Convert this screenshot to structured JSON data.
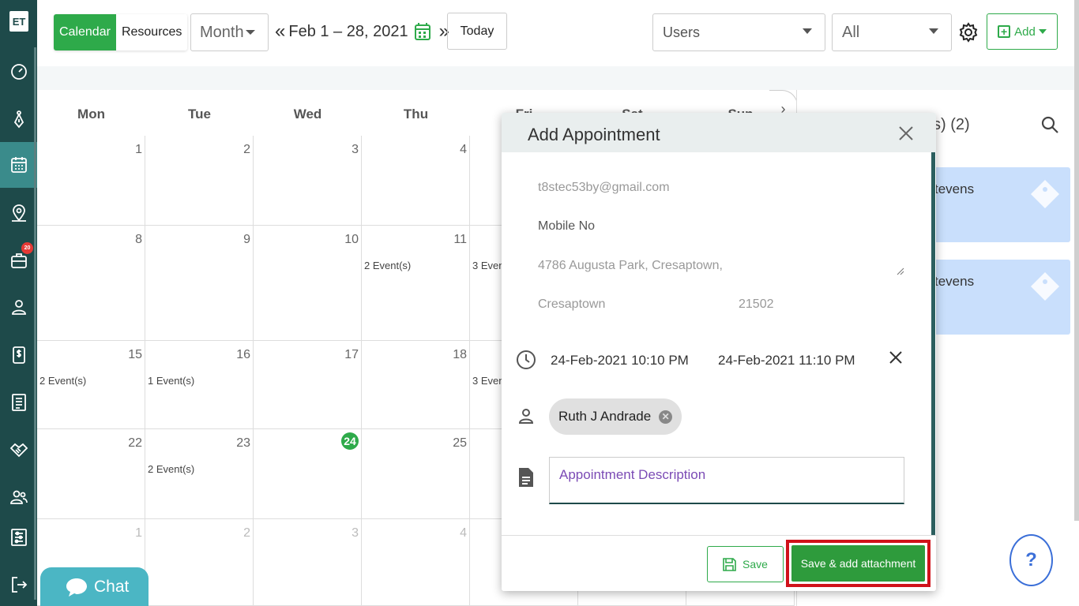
{
  "app": {
    "logo_text": "ET",
    "badge_count": "20"
  },
  "sidebar": {
    "items": [
      {
        "name": "dashboard-icon"
      },
      {
        "name": "pen-tool-icon"
      },
      {
        "name": "calendar-icon"
      },
      {
        "name": "map-pin-icon"
      },
      {
        "name": "briefcase-icon"
      },
      {
        "name": "user-icon"
      },
      {
        "name": "dollar-icon"
      },
      {
        "name": "list-icon"
      },
      {
        "name": "handshake-icon"
      },
      {
        "name": "users-icon"
      },
      {
        "name": "sliders-icon"
      },
      {
        "name": "logout-icon"
      }
    ]
  },
  "toolbar": {
    "calendar_tab": "Calendar",
    "resources_tab": "Resources",
    "view_select": "Month",
    "prev_arrow": "«",
    "date_range": "Feb 1 – 28, 2021",
    "next_arrow": "»",
    "today": "Today",
    "users_select": "Users",
    "all_select": "All",
    "add": "Add"
  },
  "calendar": {
    "weekdays": [
      "Mon",
      "Tue",
      "Wed",
      "Thu",
      "Fri",
      "Sat",
      "Sun"
    ],
    "weeks": [
      [
        {
          "d": "1",
          "ev": ""
        },
        {
          "d": "2",
          "ev": ""
        },
        {
          "d": "3",
          "ev": ""
        },
        {
          "d": "4",
          "ev": ""
        }
      ],
      [
        {
          "d": "8",
          "ev": ""
        },
        {
          "d": "9",
          "ev": ""
        },
        {
          "d": "10",
          "ev": ""
        },
        {
          "d": "11",
          "ev": "2 Event(s)"
        },
        {
          "d": "",
          "ev": "3 Even"
        }
      ],
      [
        {
          "d": "15",
          "ev": "2 Event(s)"
        },
        {
          "d": "16",
          "ev": "1 Event(s)"
        },
        {
          "d": "17",
          "ev": ""
        },
        {
          "d": "18",
          "ev": ""
        },
        {
          "d": "",
          "ev": "3 Even"
        }
      ],
      [
        {
          "d": "22",
          "ev": ""
        },
        {
          "d": "23",
          "ev": "2 Event(s)"
        },
        {
          "d": "24",
          "ev": "",
          "today": true
        },
        {
          "d": "25",
          "ev": ""
        }
      ],
      [
        {
          "d": "1",
          "ev": "",
          "faded": true
        },
        {
          "d": "2",
          "ev": "",
          "faded": true
        },
        {
          "d": "3",
          "ev": "",
          "faded": true
        },
        {
          "d": "4",
          "ev": "",
          "faded": true
        }
      ]
    ],
    "partial_headers": [
      "Fri",
      "Sat",
      "Sun"
    ],
    "next_button": "›"
  },
  "right_panel": {
    "title_fragment": "s) (2)",
    "cards": [
      {
        "name": "tevens"
      },
      {
        "name": "tevens"
      }
    ]
  },
  "modal": {
    "title": "Add Appointment",
    "email": "t8stec53by@gmail.com",
    "mobile_placeholder": "Mobile No",
    "address": "4786  Augusta Park, Cresaptown,",
    "city": "Cresaptown",
    "zip": "21502",
    "start_time": "24-Feb-2021 10:10 PM",
    "end_time": "24-Feb-2021 11:10 PM",
    "assignee": "Ruth J Andrade",
    "description_placeholder": "Appointment Description",
    "save": "Save",
    "save_attach": "Save & add attachment"
  },
  "chat": {
    "label": "Chat"
  },
  "help": {
    "label": "?"
  },
  "colors": {
    "accent": "#2eaa4a",
    "sidebar": "#1e4a4a",
    "highlight": "#d0121a"
  }
}
